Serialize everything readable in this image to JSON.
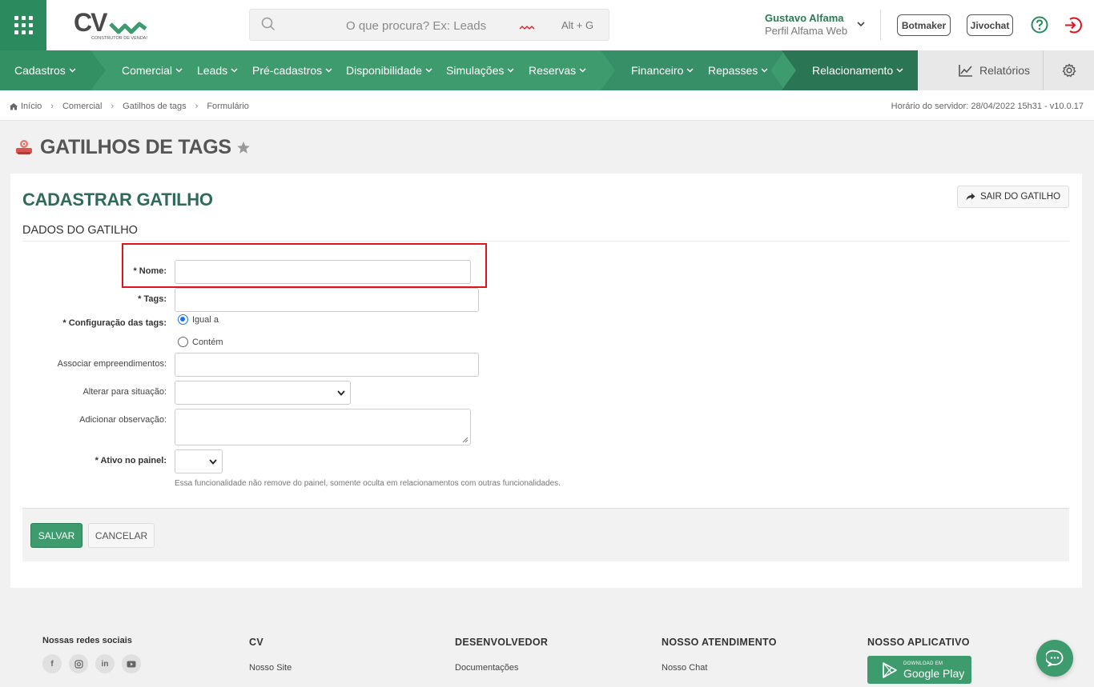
{
  "header": {
    "logo_text": "CV",
    "logo_subtitle": "CONSTRUTOR DE VENDAS",
    "search_placeholder": "O que procura? Ex: Leads",
    "search_shortcut": "Alt + G",
    "user_name": "Gustavo Alfama",
    "user_profile": "Perfil Alfama Web",
    "botmaker_label": "Botmaker",
    "jivochat_label": "Jivochat"
  },
  "nav": {
    "items": [
      {
        "label": "Cadastros"
      },
      {
        "label": "Comercial"
      },
      {
        "label": "Leads"
      },
      {
        "label": "Pré-cadastros"
      },
      {
        "label": "Disponibilidade"
      },
      {
        "label": "Simulações"
      },
      {
        "label": "Reservas"
      },
      {
        "label": "Financeiro"
      },
      {
        "label": "Repasses"
      },
      {
        "label": "Relacionamento"
      }
    ],
    "reports_label": "Relatórios"
  },
  "breadcrumb": {
    "items": [
      "Início",
      "Comercial",
      "Gatilhos de tags",
      "Formulário"
    ],
    "server_time": "Horário do servidor: 28/04/2022 15h31 - v10.0.17"
  },
  "page": {
    "title": "GATILHOS DE TAGS"
  },
  "form": {
    "card_title": "CADASTRAR GATILHO",
    "exit_button": "SAIR DO GATILHO",
    "section_title": "DADOS DO GATILHO",
    "fields": {
      "nome_label": "* Nome:",
      "nome_value": "",
      "tags_label": "* Tags:",
      "tags_value": "",
      "config_label": "* Configuração das tags:",
      "config_option_equal": "Igual a",
      "config_option_contains": "Contém",
      "empreend_label": "Associar empreendimentos:",
      "situacao_label": "Alterar para situação:",
      "situacao_value": "",
      "observacao_label": "Adicionar observação:",
      "ativo_label": "* Ativo no painel:",
      "ativo_value": "",
      "ativo_help": "Essa funcionalidade não remove do painel, somente oculta em relacionamentos com outras funcionalidades."
    },
    "save_button": "SALVAR",
    "cancel_button": "CANCELAR"
  },
  "footer": {
    "social_title": "Nossas redes sociais",
    "cv_title": "CV",
    "cv_link": "Nosso Site",
    "dev_title": "DESENVOLVEDOR",
    "dev_link": "Documentações",
    "support_title": "NOSSO ATENDIMENTO",
    "support_link": "Nosso Chat",
    "app_title": "NOSSO APLICATIVO",
    "gplay_small": "DOWNLOAD EM",
    "gplay_big": "Google Play"
  },
  "colors": {
    "brand_green": "#3d9b6d",
    "dark_green": "#2b8a5e",
    "title_green": "#2f6b57",
    "highlight_red": "#e0121d"
  },
  "icons": [
    "apps-grid-icon",
    "search-icon",
    "chevron-down-icon",
    "help-icon",
    "logout-icon",
    "chart-icon",
    "gear-icon",
    "home-icon",
    "tag-trigger-icon",
    "star-icon",
    "share-arrow-icon",
    "facebook-icon",
    "instagram-icon",
    "linkedin-icon",
    "youtube-icon",
    "google-play-icon",
    "chat-icon"
  ]
}
